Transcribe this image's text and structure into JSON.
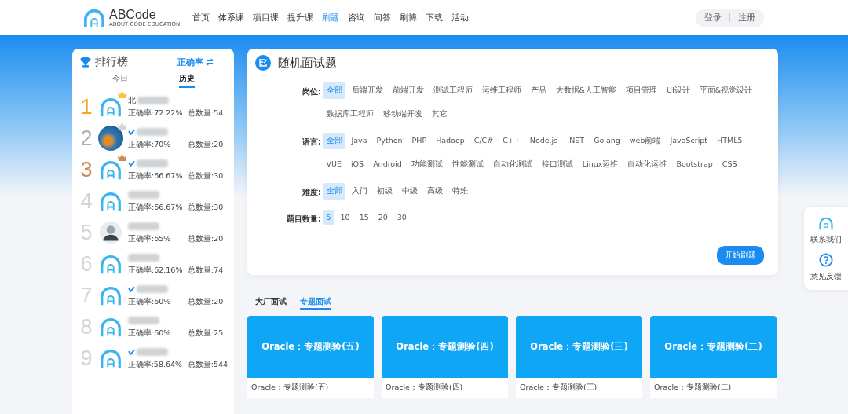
{
  "header": {
    "logo": {
      "name": "ABCode",
      "tagline": "ABOUT CODE EDUCATION"
    },
    "nav": [
      {
        "label": "首页",
        "selected": false
      },
      {
        "label": "体系课",
        "selected": false
      },
      {
        "label": "项目课",
        "selected": false
      },
      {
        "label": "提升课",
        "selected": false
      },
      {
        "label": "刷题",
        "selected": true
      },
      {
        "label": "咨询",
        "selected": false
      },
      {
        "label": "问答",
        "selected": false
      },
      {
        "label": "刷博",
        "selected": false
      },
      {
        "label": "下载",
        "selected": false
      },
      {
        "label": "活动",
        "selected": false
      }
    ],
    "auth": [
      "登录",
      "注册"
    ]
  },
  "leaderboard": {
    "title": "排行榜",
    "sort": "正确率",
    "tabs": [
      {
        "label": "今日",
        "selected": false
      },
      {
        "label": "历史",
        "selected": true
      }
    ],
    "rows": [
      {
        "rank": "1",
        "medal": {
          "kind": "gold"
        },
        "avatar": {
          "kind": "logo"
        },
        "verified": false,
        "name": "北",
        "accuracy": "正确率:72.22%",
        "total": "总数量:54"
      },
      {
        "rank": "2",
        "medal": {
          "kind": "silver"
        },
        "avatar": {
          "kind": "photo"
        },
        "verified": true,
        "accuracy": "正确率:70%",
        "total": "总数量:20"
      },
      {
        "rank": "3",
        "medal": {
          "kind": "bronze"
        },
        "avatar": {
          "kind": "logo"
        },
        "verified": true,
        "accuracy": "正确率:66.67%",
        "total": "总数量:30"
      },
      {
        "rank": "4",
        "avatar": {
          "kind": "logo"
        },
        "verified": false,
        "accuracy": "正确率:66.67%",
        "total": "总数量:30"
      },
      {
        "rank": "5",
        "avatar": {
          "kind": "person"
        },
        "verified": false,
        "accuracy": "正确率:65%",
        "total": "总数量:20"
      },
      {
        "rank": "6",
        "avatar": {
          "kind": "logo"
        },
        "verified": false,
        "accuracy": "正确率:62.16%",
        "total": "总数量:74"
      },
      {
        "rank": "7",
        "avatar": {
          "kind": "logo"
        },
        "verified": true,
        "accuracy": "正确率:60%",
        "total": "总数量:20"
      },
      {
        "rank": "8",
        "avatar": {
          "kind": "logo"
        },
        "verified": false,
        "accuracy": "正确率:60%",
        "total": "总数量:25"
      },
      {
        "rank": "9",
        "avatar": {
          "kind": "logo"
        },
        "verified": true,
        "accuracy": "正确率:58.64%",
        "total": "总数量:544"
      }
    ]
  },
  "quiz": {
    "title": "随机面试题",
    "filters": [
      {
        "label": "岗位:",
        "options": [
          {
            "label": "全部",
            "selected": true
          },
          {
            "label": "后端开发",
            "selected": false
          },
          {
            "label": "前端开发",
            "selected": false
          },
          {
            "label": "测试工程师",
            "selected": false
          },
          {
            "label": "运维工程师",
            "selected": false
          },
          {
            "label": "产品",
            "selected": false
          },
          {
            "label": "大数据&人工智能",
            "selected": false
          },
          {
            "label": "项目管理",
            "selected": false
          },
          {
            "label": "UI设计",
            "selected": false
          },
          {
            "label": "平面&视觉设计",
            "selected": false
          },
          {
            "label": "数据库工程师",
            "selected": false
          },
          {
            "label": "移动端开发",
            "selected": false
          },
          {
            "label": "其它",
            "selected": false
          }
        ]
      },
      {
        "label": "语言:",
        "options": [
          {
            "label": "全部",
            "selected": true
          },
          {
            "label": "Java",
            "selected": false
          },
          {
            "label": "Python",
            "selected": false
          },
          {
            "label": "PHP",
            "selected": false
          },
          {
            "label": "Hadoop",
            "selected": false
          },
          {
            "label": "C/C#",
            "selected": false
          },
          {
            "label": "C++",
            "selected": false
          },
          {
            "label": "Node.js",
            "selected": false
          },
          {
            "label": ".NET",
            "selected": false
          },
          {
            "label": "Golang",
            "selected": false
          },
          {
            "label": "web前端",
            "selected": false
          },
          {
            "label": "JavaScript",
            "selected": false
          },
          {
            "label": "HTML5",
            "selected": false
          },
          {
            "label": "VUE",
            "selected": false
          },
          {
            "label": "iOS",
            "selected": false
          },
          {
            "label": "Android",
            "selected": false
          },
          {
            "label": "功能测试",
            "selected": false
          },
          {
            "label": "性能测试",
            "selected": false
          },
          {
            "label": "自动化测试",
            "selected": false
          },
          {
            "label": "接口测试",
            "selected": false
          },
          {
            "label": "Linux运维",
            "selected": false
          },
          {
            "label": "自动化运维",
            "selected": false
          },
          {
            "label": "Bootstrap",
            "selected": false
          },
          {
            "label": "CSS",
            "selected": false
          }
        ]
      },
      {
        "label": "难度:",
        "options": [
          {
            "label": "全部",
            "selected": true
          },
          {
            "label": "入门",
            "selected": false
          },
          {
            "label": "初级",
            "selected": false
          },
          {
            "label": "中级",
            "selected": false
          },
          {
            "label": "高级",
            "selected": false
          },
          {
            "label": "特难",
            "selected": false
          }
        ]
      },
      {
        "label": "题目数量:",
        "options": [
          {
            "label": "5",
            "selected": true
          },
          {
            "label": "10",
            "selected": false
          },
          {
            "label": "15",
            "selected": false
          },
          {
            "label": "20",
            "selected": false
          },
          {
            "label": "30",
            "selected": false
          }
        ]
      }
    ],
    "start_button": "开始刷题"
  },
  "section_tabs": [
    {
      "label": "大厂面试",
      "selected": false
    },
    {
      "label": "专题面试",
      "selected": true
    }
  ],
  "cards": [
    {
      "title": "Oracle：专题测验(五)",
      "caption": "Oracle：专题测验(五)"
    },
    {
      "title": "Oracle：专题测验(四)",
      "caption": "Oracle：专题测验(四)"
    },
    {
      "title": "Oracle：专题测验(三)",
      "caption": "Oracle：专题测验(三)"
    },
    {
      "title": "Oracle：专题测验(二)",
      "caption": "Oracle：专题测验(二)"
    }
  ],
  "side_widget": [
    {
      "kind": "logo",
      "label": "联系我们"
    },
    {
      "kind": "help",
      "label": "意见反馈"
    }
  ]
}
